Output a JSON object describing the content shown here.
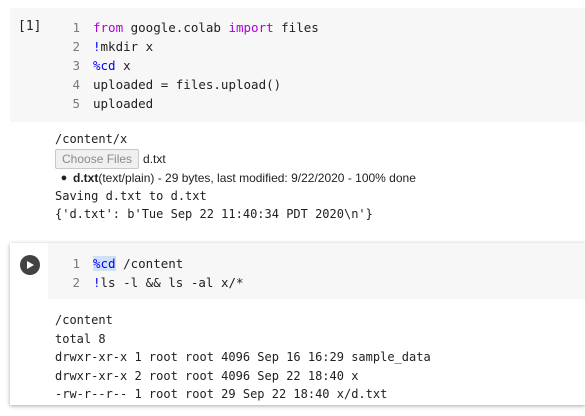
{
  "cell1": {
    "execution_count": "[1]",
    "lines": [
      {
        "num": "1",
        "tokens": [
          {
            "text": "from",
            "cls": "kw"
          },
          {
            "text": " google.colab ",
            "cls": "tx"
          },
          {
            "text": "import",
            "cls": "kw"
          },
          {
            "text": " files",
            "cls": "tx"
          }
        ]
      },
      {
        "num": "2",
        "tokens": [
          {
            "text": "!",
            "cls": "mg"
          },
          {
            "text": "mkdir x",
            "cls": "tx"
          }
        ]
      },
      {
        "num": "3",
        "tokens": [
          {
            "text": "%cd",
            "cls": "mg"
          },
          {
            "text": " x",
            "cls": "tx"
          }
        ]
      },
      {
        "num": "4",
        "tokens": [
          {
            "text": "uploaded = files.upload()",
            "cls": "tx"
          }
        ]
      },
      {
        "num": "5",
        "tokens": [
          {
            "text": "uploaded",
            "cls": "tx"
          }
        ]
      }
    ]
  },
  "output1": {
    "cwd": "/content/x",
    "choose_files_label": "Choose Files",
    "chosen_file": "d.txt",
    "upload_item": {
      "name": "d.txt",
      "details": "(text/plain) - 29 bytes, last modified: 9/22/2020 - 100% done"
    },
    "saving": "Saving d.txt to d.txt",
    "result": "{'d.txt': b'Tue Sep 22 11:40:34 PDT 2020\\n'}"
  },
  "cell2": {
    "lines": [
      {
        "num": "1",
        "tokens": [
          {
            "text": "%cd",
            "cls": "mg hl"
          },
          {
            "text": " /content",
            "cls": "tx"
          }
        ]
      },
      {
        "num": "2",
        "tokens": [
          {
            "text": "!",
            "cls": "mg"
          },
          {
            "text": "ls -l && ls -al x/*",
            "cls": "tx"
          }
        ]
      }
    ]
  },
  "output2": {
    "lines": [
      "/content",
      "total 8",
      "drwxr-xr-x 1 root root 4096 Sep 16 16:29 sample_data",
      "drwxr-xr-x 2 root root 4096 Sep 22 18:40 x",
      "-rw-r--r-- 1 root root 29 Sep 22 18:40 x/d.txt"
    ]
  },
  "icons": {
    "run": "play-icon"
  }
}
